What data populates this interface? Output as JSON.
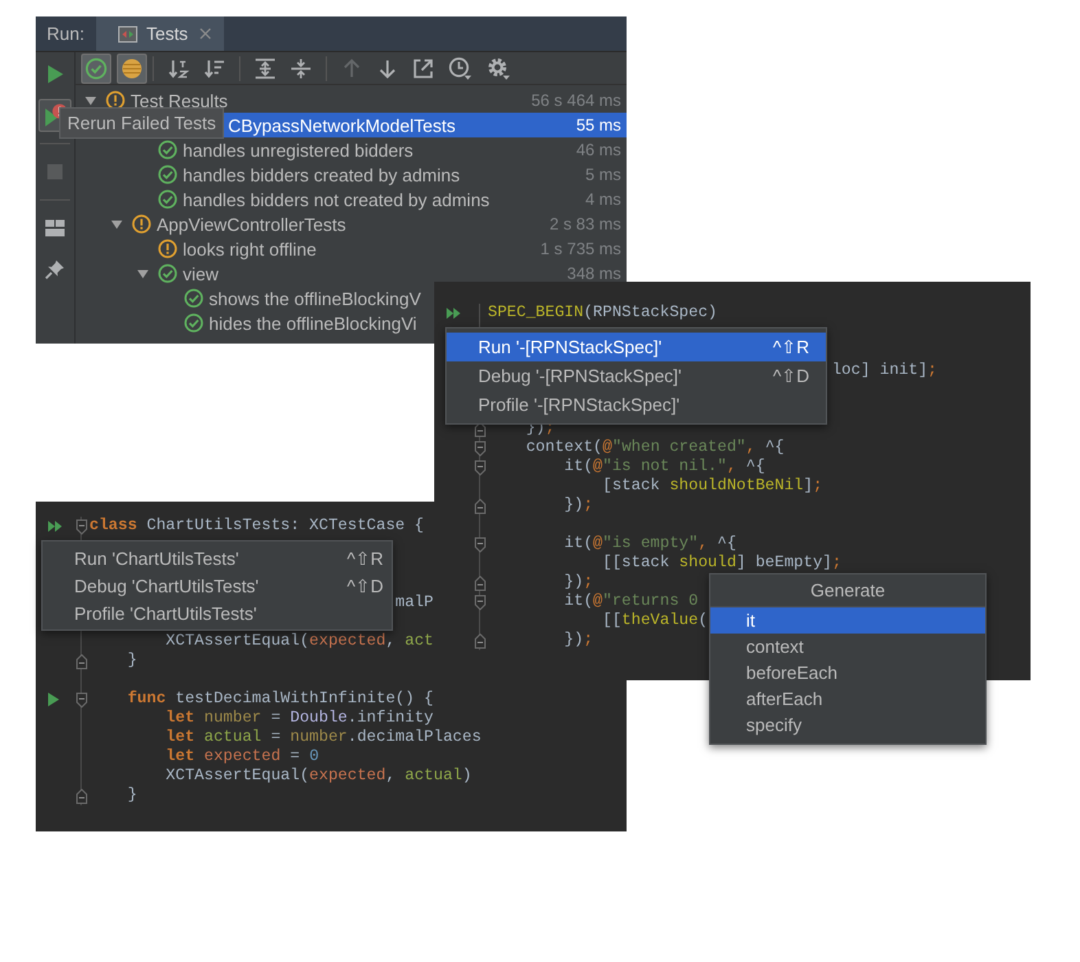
{
  "run_window": {
    "header_label": "Run:",
    "tab": {
      "label": "Tests",
      "selected": true
    },
    "side_tools": [
      {
        "kind": "run",
        "disabled": false
      },
      {
        "kind": "rerun-failed",
        "disabled": false
      },
      {
        "kind": "stop",
        "disabled": true
      },
      {
        "kind": "layout",
        "disabled": false
      },
      {
        "kind": "pin",
        "disabled": false
      }
    ],
    "filters": [
      {
        "kind": "show-passed",
        "selected": true
      },
      {
        "kind": "show-ignored",
        "selected": true
      }
    ],
    "action_groups": [
      [
        {
          "kind": "sort-alpha",
          "disabled": false
        },
        {
          "kind": "sort-duration",
          "disabled": false
        }
      ],
      [
        {
          "kind": "expand-all",
          "disabled": false
        },
        {
          "kind": "collapse-all",
          "disabled": false
        }
      ],
      [
        {
          "kind": "previous",
          "disabled": true
        },
        {
          "kind": "next",
          "disabled": false
        },
        {
          "kind": "export",
          "disabled": false
        },
        {
          "kind": "history",
          "disabled": false
        },
        {
          "kind": "settings",
          "disabled": false
        }
      ]
    ],
    "tree": [
      {
        "label": "Test Results",
        "kind": "warning",
        "time": "56 s 464 ms",
        "selected": false,
        "expanded": true,
        "children": [
          {
            "label": "CBypassNetworkModelTests",
            "obscured": true,
            "time": "55 ms",
            "selected": true,
            "children": [
              {
                "label": "handles unregistered bidders",
                "kind": "passed",
                "time": "46 ms",
                "selected": false
              },
              {
                "label": "handles bidders created by admins",
                "kind": "passed",
                "time": "5 ms",
                "selected": false
              },
              {
                "label": "handles bidders not created by admins",
                "kind": "passed",
                "time": "4 ms",
                "selected": false
              }
            ]
          },
          {
            "label": "AppViewControllerTests",
            "kind": "warning",
            "time": "2 s 83 ms",
            "selected": false,
            "expanded": true,
            "children": [
              {
                "label": "looks right offline",
                "kind": "warning",
                "time": "1 s 735 ms",
                "selected": false
              },
              {
                "label": "view",
                "kind": "passed",
                "time": "348 ms",
                "selected": false,
                "expanded": true,
                "children": [
                  {
                    "label": "shows the offlineBlockingV",
                    "kind": "passed",
                    "selected": false
                  },
                  {
                    "label": "hides the offlineBlockingVi",
                    "kind": "passed",
                    "selected": false
                  }
                ]
              }
            ]
          }
        ]
      }
    ],
    "tooltip": "Rerun Failed Tests"
  },
  "swift_editor": {
    "lines": [
      {
        "kind": "code",
        "run_suite": true,
        "fold_start": true,
        "tokens": [
          {
            "kind": "keyword",
            "text": "class"
          },
          {
            "kind": "plain",
            "text": " ChartUtilsTests: XCTestCase {"
          }
        ]
      },
      {
        "kind": "blank"
      },
      {
        "kind": "blank"
      },
      {
        "kind": "blank"
      },
      {
        "kind": "code",
        "tokens": [
          {
            "kind": "plain",
            "text": "                                malP"
          }
        ]
      },
      {
        "kind": "blank"
      },
      {
        "kind": "code",
        "tokens": [
          {
            "kind": "plain",
            "text": "        XCTAssertEqual("
          },
          {
            "kind": "expect",
            "text": "expected"
          },
          {
            "kind": "plain",
            "text": ", "
          },
          {
            "kind": "result",
            "text": "act"
          }
        ]
      },
      {
        "kind": "code",
        "fold_end": true,
        "tokens": [
          {
            "kind": "plain",
            "text": "    }"
          }
        ]
      },
      {
        "kind": "blank"
      },
      {
        "kind": "code",
        "run_test": true,
        "fold_start": true,
        "tokens": [
          {
            "kind": "keyword",
            "text": "    func"
          },
          {
            "kind": "plain",
            "text": " testDecimalWithInfinite() {"
          }
        ]
      },
      {
        "kind": "code",
        "tokens": [
          {
            "kind": "keyword",
            "text": "        let "
          },
          {
            "kind": "local",
            "text": "number"
          },
          {
            "kind": "plain",
            "text": " = "
          },
          {
            "kind": "typename",
            "text": "Double"
          },
          {
            "kind": "plain",
            "text": ".infinity"
          }
        ]
      },
      {
        "kind": "code",
        "tokens": [
          {
            "kind": "keyword",
            "text": "        let "
          },
          {
            "kind": "result",
            "text": "actual"
          },
          {
            "kind": "plain",
            "text": " = "
          },
          {
            "kind": "local",
            "text": "number"
          },
          {
            "kind": "plain",
            "text": ".decimalPlaces"
          }
        ]
      },
      {
        "kind": "code",
        "tokens": [
          {
            "kind": "keyword",
            "text": "        let "
          },
          {
            "kind": "expect",
            "text": "expected"
          },
          {
            "kind": "plain",
            "text": " = "
          },
          {
            "kind": "numeral",
            "text": "0"
          }
        ]
      },
      {
        "kind": "code",
        "tokens": [
          {
            "kind": "plain",
            "text": "        XCTAssertEqual("
          },
          {
            "kind": "expect",
            "text": "expected"
          },
          {
            "kind": "plain",
            "text": ", "
          },
          {
            "kind": "result",
            "text": "actual"
          },
          {
            "kind": "plain",
            "text": ")"
          }
        ]
      },
      {
        "kind": "code",
        "fold_end": true,
        "tokens": [
          {
            "kind": "plain",
            "text": "    }"
          }
        ]
      }
    ],
    "menu": [
      {
        "label": "Run 'ChartUtilsTests'",
        "shortcut": "^⇧R",
        "selected": false
      },
      {
        "label": "Debug 'ChartUtilsTests'",
        "shortcut": "^⇧D",
        "selected": false
      },
      {
        "label": "Profile 'ChartUtilsTests'",
        "selected": false
      }
    ]
  },
  "spec_editor": {
    "lines": [
      {
        "kind": "code",
        "run_suite": true,
        "tokens": [
          {
            "kind": "macro",
            "text": "SPEC_BEGIN"
          },
          {
            "kind": "plain",
            "text": "(RPNStackSpec)"
          }
        ]
      },
      {
        "kind": "blank"
      },
      {
        "kind": "blank"
      },
      {
        "kind": "code",
        "tokens": [
          {
            "kind": "plain",
            "text": "                                    loc] init]"
          },
          {
            "kind": "punct",
            "text": ";"
          }
        ]
      },
      {
        "kind": "blank"
      },
      {
        "kind": "blank"
      },
      {
        "kind": "code",
        "fold_end": true,
        "tokens": [
          {
            "kind": "plain",
            "text": "    })"
          },
          {
            "kind": "punct",
            "text": ";"
          }
        ]
      },
      {
        "kind": "code",
        "fold_start": true,
        "tokens": [
          {
            "kind": "plain",
            "text": "    context("
          },
          {
            "kind": "punct",
            "text": "@"
          },
          {
            "kind": "string",
            "text": "\"when created\""
          },
          {
            "kind": "punct",
            "text": ","
          },
          {
            "kind": "plain",
            "text": " ^{"
          }
        ]
      },
      {
        "kind": "code",
        "fold_start": true,
        "tokens": [
          {
            "kind": "plain",
            "text": "        it("
          },
          {
            "kind": "punct",
            "text": "@"
          },
          {
            "kind": "string",
            "text": "\"is not nil.\""
          },
          {
            "kind": "punct",
            "text": ","
          },
          {
            "kind": "plain",
            "text": " ^{"
          }
        ]
      },
      {
        "kind": "code",
        "tokens": [
          {
            "kind": "plain",
            "text": "            [stack "
          },
          {
            "kind": "macro",
            "text": "shouldNotBeNil"
          },
          {
            "kind": "plain",
            "text": "]"
          },
          {
            "kind": "punct",
            "text": ";"
          }
        ]
      },
      {
        "kind": "code",
        "fold_end": true,
        "tokens": [
          {
            "kind": "plain",
            "text": "        })"
          },
          {
            "kind": "punct",
            "text": ";"
          }
        ]
      },
      {
        "kind": "blank"
      },
      {
        "kind": "code",
        "fold_start": true,
        "tokens": [
          {
            "kind": "plain",
            "text": "        it("
          },
          {
            "kind": "punct",
            "text": "@"
          },
          {
            "kind": "string",
            "text": "\"is empty\""
          },
          {
            "kind": "punct",
            "text": ","
          },
          {
            "kind": "plain",
            "text": " ^{"
          }
        ]
      },
      {
        "kind": "code",
        "tokens": [
          {
            "kind": "plain",
            "text": "            [[stack "
          },
          {
            "kind": "macro",
            "text": "should"
          },
          {
            "kind": "plain",
            "text": "] beEmpty]"
          },
          {
            "kind": "punct",
            "text": ";"
          }
        ]
      },
      {
        "kind": "code",
        "fold_end": true,
        "tokens": [
          {
            "kind": "plain",
            "text": "        })"
          },
          {
            "kind": "punct",
            "text": ";"
          }
        ]
      },
      {
        "kind": "code",
        "fold_start": true,
        "tokens": [
          {
            "kind": "plain",
            "text": "        it("
          },
          {
            "kind": "punct",
            "text": "@"
          },
          {
            "kind": "string",
            "text": "\"returns 0"
          }
        ]
      },
      {
        "kind": "code",
        "tokens": [
          {
            "kind": "plain",
            "text": "            [["
          },
          {
            "kind": "macro",
            "text": "theValue"
          },
          {
            "kind": "plain",
            "text": "("
          }
        ]
      },
      {
        "kind": "code",
        "fold_end": true,
        "tokens": [
          {
            "kind": "plain",
            "text": "        })"
          },
          {
            "kind": "punct",
            "text": ";"
          }
        ]
      }
    ],
    "menu": [
      {
        "label": "Run '-[RPNStackSpec]'",
        "shortcut": "^⇧R",
        "selected": true
      },
      {
        "label": "Debug '-[RPNStackSpec]'",
        "shortcut": "^⇧D",
        "selected": false
      },
      {
        "label": "Profile '-[RPNStackSpec]'",
        "selected": false
      }
    ],
    "generate_popup": {
      "title": "Generate",
      "items": [
        {
          "label": "it",
          "selected": true
        },
        {
          "label": "context",
          "selected": false
        },
        {
          "label": "beforeEach",
          "selected": false
        },
        {
          "label": "afterEach",
          "selected": false
        },
        {
          "label": "specify",
          "selected": false
        }
      ]
    }
  }
}
